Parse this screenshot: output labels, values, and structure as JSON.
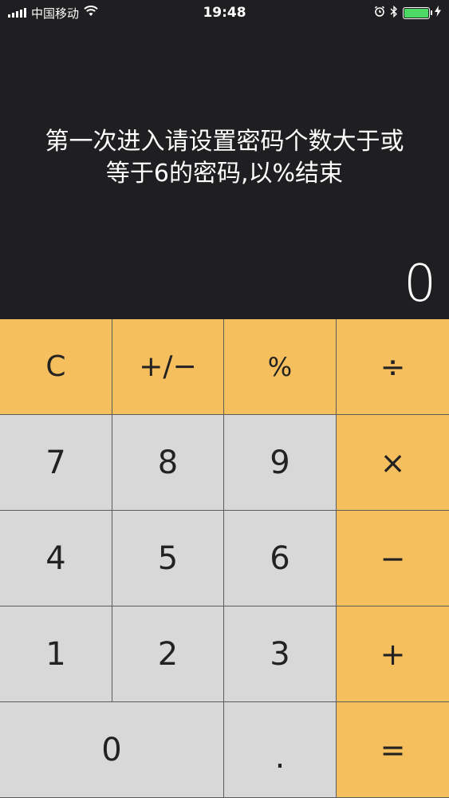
{
  "status_bar": {
    "carrier": "中国移动",
    "time": "19:48"
  },
  "message": {
    "line1": "第一次进入请设置密码个数大于或",
    "line2": "等于6的密码,以%结束"
  },
  "display": {
    "value": "0"
  },
  "keys": {
    "clear": "C",
    "sign": "+/−",
    "percent": "%",
    "divide": "÷",
    "seven": "7",
    "eight": "8",
    "nine": "9",
    "multiply": "×",
    "four": "4",
    "five": "5",
    "six": "6",
    "minus": "−",
    "one": "1",
    "two": "2",
    "three": "3",
    "plus": "+",
    "zero": "0",
    "decimal": ".",
    "equals": "="
  },
  "colors": {
    "accent": "#f5bf5e",
    "number_key": "#d8d8d8",
    "background": "#1f1f21",
    "battery": "#4cd964"
  }
}
